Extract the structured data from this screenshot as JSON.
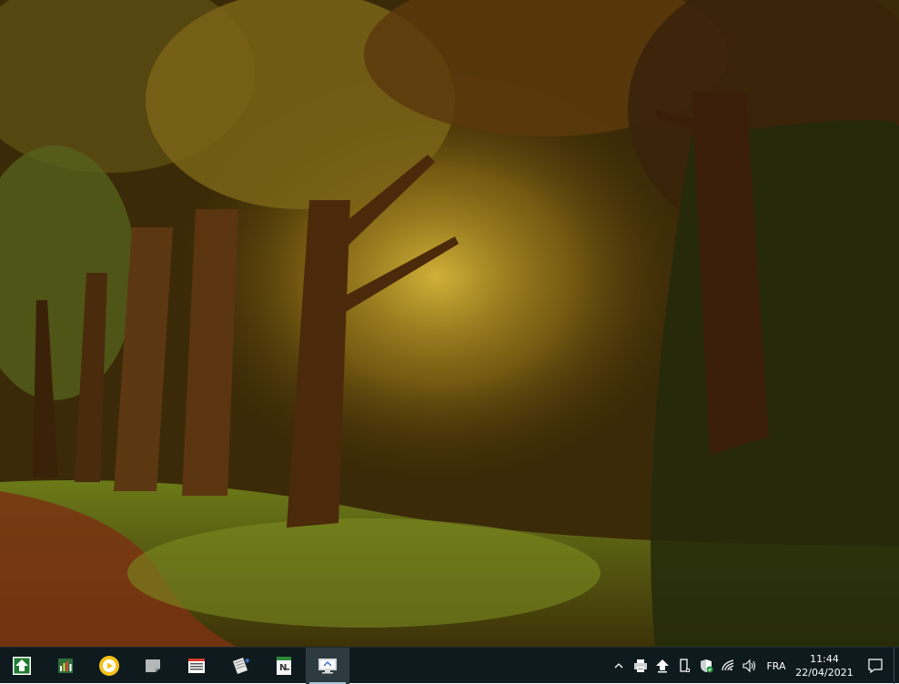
{
  "desktop": {
    "wallpaper": "autumn-forest-path-wallpaper"
  },
  "taskbar": {
    "background": "#0f1a1f",
    "apps": [
      {
        "name": "install-arrow-icon"
      },
      {
        "name": "spreadsheet-app-icon"
      },
      {
        "name": "media-player-icon"
      },
      {
        "name": "sticky-notes-icon"
      },
      {
        "name": "list-document-icon"
      },
      {
        "name": "notepad-icon"
      },
      {
        "name": "notepad-plus-icon"
      },
      {
        "name": "remote-desktop-icon",
        "active": true
      }
    ],
    "tray": {
      "icons": [
        {
          "name": "chevron-up-icon"
        },
        {
          "name": "printer-icon"
        },
        {
          "name": "upload-arrow-icon"
        },
        {
          "name": "usb-device-icon"
        },
        {
          "name": "security-shield-icon"
        },
        {
          "name": "wifi-icon"
        },
        {
          "name": "speaker-icon"
        }
      ],
      "language": "FRA",
      "time": "11:44",
      "date": "22/04/2021"
    }
  }
}
